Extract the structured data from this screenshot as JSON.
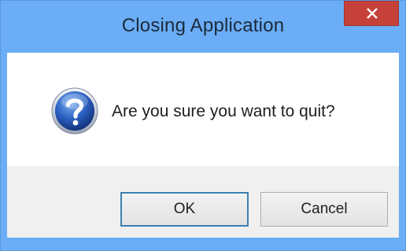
{
  "window": {
    "title": "Closing Application",
    "title_bar_color": "#6badf6",
    "close_button_color": "#c7413b",
    "close_icon": "close-icon"
  },
  "dialog": {
    "icon": "question-icon",
    "message": "Are you sure you want to quit?"
  },
  "buttons": {
    "ok_label": "OK",
    "cancel_label": "Cancel",
    "default": "OK"
  }
}
